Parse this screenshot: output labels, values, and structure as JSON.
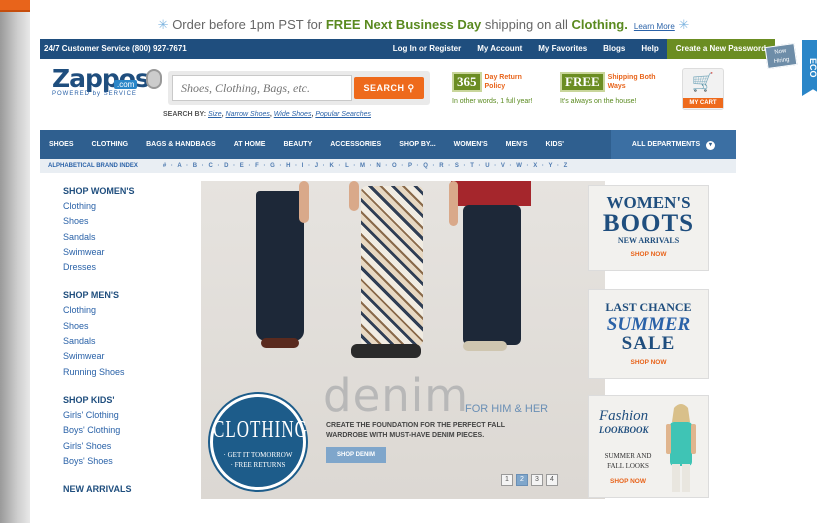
{
  "promo_bar": {
    "prefix": "Order before 1pm PST for ",
    "highlight1": "FREE Next Business Day",
    "middle": " shipping on all ",
    "highlight2": "Clothing.",
    "learn_more": "Learn More"
  },
  "top_bar": {
    "customer_service": "24/7 Customer Service (800) 927-7671",
    "links": [
      "Log In or Register",
      "My Account",
      "My Favorites",
      "Blogs",
      "Help"
    ],
    "create_password": "Create a New Password"
  },
  "now_hiring": "Now Hiring",
  "eco": "ECO",
  "logo": {
    "word": "Zappos",
    "dotcom": ".com",
    "tagline": "POWERED by SERVICE"
  },
  "search": {
    "placeholder": "Shoes, Clothing, Bags, etc.",
    "button": "SEARCH",
    "search_by_label": "SEARCH BY:",
    "search_by_links": [
      "Size",
      "Narrow Shoes",
      "Wide Shoes",
      "Popular Searches"
    ]
  },
  "policies": [
    {
      "badge": "365",
      "head": "Day Return Policy",
      "sub": "In other words, 1 full year!"
    },
    {
      "badge": "FREE",
      "head": "Shipping Both Ways",
      "sub": "It's always on the house!"
    }
  ],
  "cart": {
    "label": "MY CART"
  },
  "main_nav": {
    "items": [
      "SHOES",
      "CLOTHING",
      "BAGS & HANDBAGS",
      "AT HOME",
      "BEAUTY",
      "ACCESSORIES",
      "SHOP BY...",
      "WOMEN'S",
      "MEN'S",
      "KIDS'"
    ],
    "all_departments": "ALL DEPARTMENTS"
  },
  "brand_index": {
    "label": "ALPHABETICAL BRAND INDEX",
    "letters": "# · A · B · C · D · E · F · G · H · I · J · K · L · M · N · O · P · Q · R · S · T · U · V · W · X · Y · Z"
  },
  "sidebar": {
    "women": {
      "head": "SHOP WOMEN'S",
      "links": [
        "Clothing",
        "Shoes",
        "Sandals",
        "Swimwear",
        "Dresses"
      ]
    },
    "men": {
      "head": "SHOP MEN'S",
      "links": [
        "Clothing",
        "Shoes",
        "Sandals",
        "Swimwear",
        "Running Shoes"
      ]
    },
    "kids": {
      "head": "SHOP KIDS'",
      "links": [
        "Girls' Clothing",
        "Boys' Clothing",
        "Girls' Shoes",
        "Boys' Shoes"
      ]
    },
    "new_arrivals": "NEW ARRIVALS"
  },
  "hero": {
    "badge_title": "CLOTHING",
    "badge_line1": "· GET IT TOMORROW",
    "badge_line2": "· FREE RETURNS",
    "headline": "denim",
    "subhead": "FOR HIM & HER",
    "copy_line1": "CREATE THE FOUNDATION FOR THE PERFECT FALL",
    "copy_line2": "WARDROBE WITH MUST-HAVE DENIM PIECES.",
    "button": "SHOP DENIM",
    "pages": [
      "1",
      "2",
      "3",
      "4"
    ],
    "active_page": 2
  },
  "promo_cards": {
    "boots": {
      "line1": "WOMEN'S",
      "line2": "BOOTS",
      "line3": "NEW ARRIVALS",
      "cta": "SHOP NOW"
    },
    "summer": {
      "line1": "LAST CHANCE",
      "line2": "SUMMER",
      "line3": "SALE",
      "cta": "SHOP NOW"
    },
    "lookbook": {
      "line1": "Fashion",
      "line2": "LOOKBOOK",
      "line3": "SUMMER AND FALL LOOKS",
      "cta": "SHOP NOW"
    }
  },
  "colors": {
    "brand_blue": "#1f4e7e",
    "link_blue": "#2a62a8",
    "accent_orange": "#ee6a1c",
    "green": "#6b8d22"
  }
}
